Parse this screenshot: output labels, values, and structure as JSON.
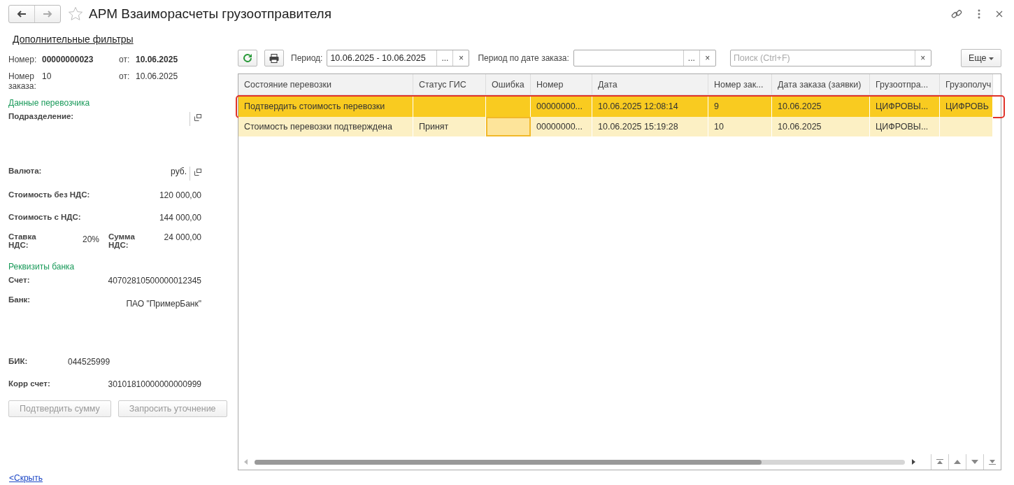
{
  "window": {
    "title": "АРМ Взаиморасчеты грузоотправителя"
  },
  "filters_link": "Дополнительные фильтры",
  "document": {
    "number_label": "Номер:",
    "number": "00000000023",
    "number_date_label": "от:",
    "number_date": "10.06.2025",
    "order_label": "Номер заказа:",
    "order": "10",
    "order_date_label": "от:",
    "order_date": "10.06.2025"
  },
  "carrier": {
    "title": "Данные перевозчика",
    "fields": [
      {
        "kind": "ref",
        "label": "Подразделение:"
      },
      {
        "kind": "ref",
        "label": "Валюта:",
        "value": "руб."
      },
      {
        "kind": "amount",
        "label": "Стоимость без НДС:",
        "value": "120 000,00"
      },
      {
        "kind": "amount",
        "label": "Стоимость с НДС:",
        "value": "144 000,00"
      },
      {
        "kind": "pair",
        "label": "Ставка НДС:",
        "value": "20%",
        "label2": "Сумма НДС:",
        "value2": "24 000,00"
      }
    ]
  },
  "bank": {
    "title": "Реквизиты банка",
    "fields": [
      {
        "kind": "amount",
        "label": "Счет:",
        "value": "40702810500000012345"
      },
      {
        "kind": "tall",
        "label": "Банк:",
        "value": "ПАО \"ПримерБанк\""
      },
      {
        "kind": "short",
        "label": "БИК:",
        "value": "044525999"
      },
      {
        "kind": "amount",
        "label": "Корр счет:",
        "value": "30101810000000000999"
      }
    ]
  },
  "actions": [
    {
      "label": "Подтвердить сумму",
      "disabled": true
    },
    {
      "label": "Запросить уточнение",
      "disabled": true
    }
  ],
  "hide_link": "<Скрыть",
  "toolbar": {
    "period_label": "Период:",
    "period": "10.06.2025 - 10.06.2025",
    "order_period_label": "Период по дате заказа:",
    "search_placeholder": "Поиск (Ctrl+F)",
    "more": "Еще",
    "select_button": "...",
    "clear_button": "×"
  },
  "table": {
    "columns": [
      "Состояние перевозки",
      "Статус ГИС",
      "Ошибка",
      "Номер",
      "Дата",
      "Номер зак...",
      "Дата заказа (заявки)",
      "Грузоотпра...",
      "Грузополуч"
    ],
    "rows": [
      {
        "selected": true,
        "outlined": true,
        "cells": [
          {
            "text": "Подтвердить стоимость перевозки",
            "focused": false
          },
          {
            "focused": false
          },
          {
            "focused": false
          },
          {
            "text": "00000000...",
            "focused": false
          },
          {
            "text": "10.06.2025 12:08:14",
            "focused": false
          },
          {
            "text": "9",
            "focused": false
          },
          {
            "text": "10.06.2025",
            "focused": false
          },
          {
            "text": "ЦИФРОВЫ...",
            "focused": false
          },
          {
            "text": "ЦИФРОВЬ",
            "focused": false
          }
        ]
      },
      {
        "selected": false,
        "outlined": false,
        "cells": [
          {
            "text": "Стоимость перевозки подтверждена",
            "focused": false
          },
          {
            "text": "Принят",
            "focused": false
          },
          {
            "focused": true
          },
          {
            "text": "00000000...",
            "focused": false
          },
          {
            "text": "10.06.2025 15:19:28",
            "focused": false
          },
          {
            "text": "10",
            "focused": false
          },
          {
            "text": "10.06.2025",
            "focused": false
          },
          {
            "text": "ЦИФРОВЫ...",
            "focused": false
          },
          {
            "focused": false
          }
        ]
      }
    ]
  }
}
